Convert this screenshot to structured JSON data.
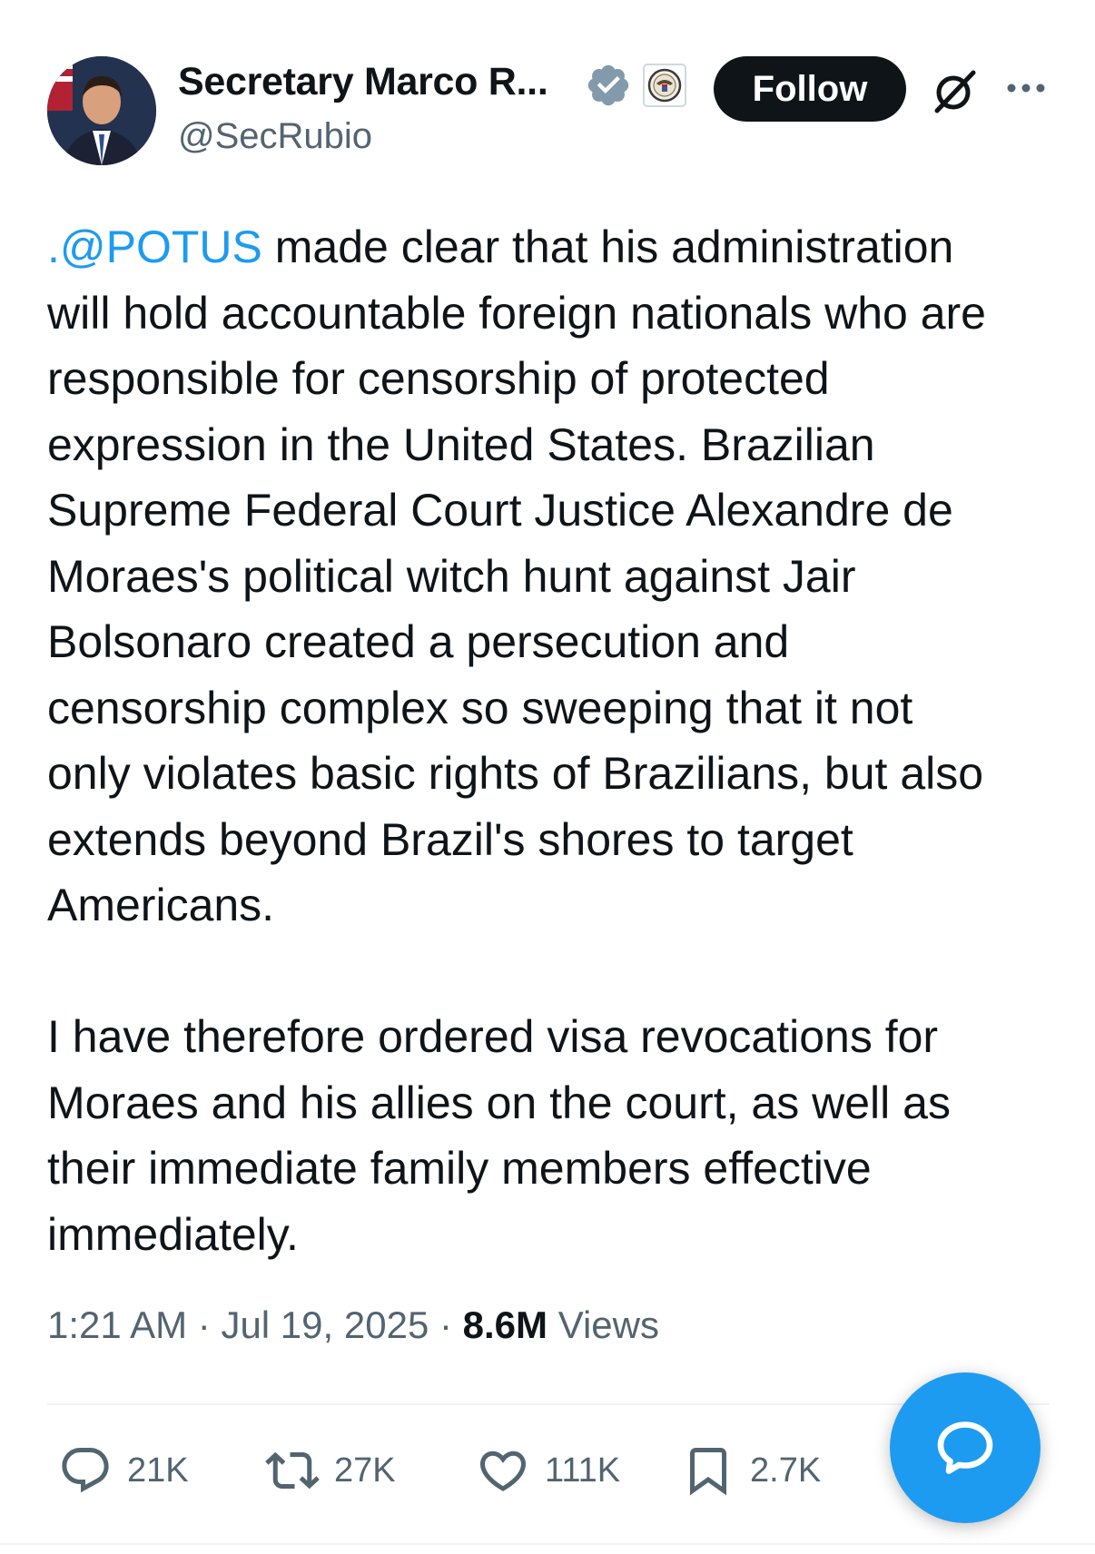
{
  "author": {
    "name": "Secretary Marco R...",
    "handle": "@SecRubio"
  },
  "header": {
    "follow_label": "Follow"
  },
  "tweet": {
    "mention": ".@POTUS",
    "lines": [
      " made clear that his administration",
      "will hold accountable foreign nationals who are",
      "responsible for censorship of protected",
      "expression in the United States. Brazilian",
      "Supreme Federal Court Justice Alexandre de",
      "Moraes's political witch hunt against Jair",
      "Bolsonaro created a persecution and",
      "censorship complex so sweeping that it not",
      "only violates basic rights of Brazilians, but also",
      "extends beyond Brazil's shores to target",
      "Americans.",
      "I have therefore ordered visa revocations for",
      "Moraes and his allies on the court, as well as",
      "their immediate family members effective",
      "immediately."
    ]
  },
  "meta": {
    "time": "1:21 AM",
    "separator": "·",
    "date": "Jul 19, 2025",
    "views_count": "8.6M",
    "views_label": "Views"
  },
  "actions": {
    "replies": "21K",
    "reposts": "27K",
    "likes": "111K",
    "bookmarks": "2.7K"
  },
  "colors": {
    "accent": "#1d9bf0",
    "text": "#0f1419",
    "secondary": "#536471"
  },
  "icons": {
    "verified": "verified-badge-icon",
    "affiliation": "state-department-seal-icon",
    "grok": "grok-icon",
    "more": "more-icon",
    "reply": "reply-icon",
    "repost": "repost-icon",
    "like": "heart-icon",
    "bookmark": "bookmark-icon",
    "compose": "chat-bubble-icon"
  }
}
